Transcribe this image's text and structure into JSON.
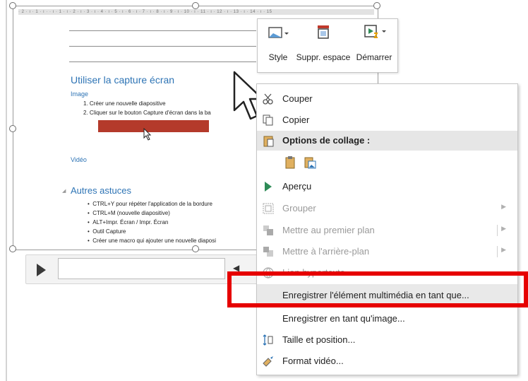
{
  "ruler": {
    "text": "· 2 · ı · 1 · ı ·   · ı · 1 · ı · 2 · ı · 3 · ı · 4 · ı · 5 · ı · 6 · ı · 7 · ı · 8 · ı · 9 · ı · 10 · ı · 11 · ı · 12 · ı · 13 · ı · 14 · ı · 15"
  },
  "doc": {
    "heading": "Utiliser la capture écran",
    "image_label": "Image",
    "steps": [
      "1.   Créer une nouvelle diapositive",
      "2.   Cliquer sur le bouton Capture d'écran dans la ba"
    ],
    "video_label": "Vidéo",
    "tips_heading": "Autres astuces",
    "tips": [
      "CTRL+Y pour répéter l'application de la bordure",
      "CTRL+M (nouvelle diapositive)",
      "ALT+Impr. Écran / Impr. Écran",
      "Outil Capture",
      "Créer une macro qui ajouter une nouvelle diaposi"
    ]
  },
  "mini_toolbar": {
    "style": "Style",
    "suppr": "Suppr. espace",
    "start": "Démarrer"
  },
  "menu": {
    "cut": "Couper",
    "copy": "Copier",
    "paste_options": "Options de collage :",
    "preview": "Aperçu",
    "group": "Grouper",
    "bring_front": "Mettre au premier plan",
    "send_back": "Mettre à l'arrière-plan",
    "hyperlink": "Lien hypertexte",
    "save_media": "Enregistrer l'élément multimédia en tant que...",
    "save_image": "Enregistrer en tant qu'image...",
    "size_pos": "Taille et position...",
    "format_video": "Format vidéo..."
  },
  "colors": {
    "highlight": "#e60000",
    "heading": "#2e74b5",
    "capture_bar": "#b43a2b"
  }
}
